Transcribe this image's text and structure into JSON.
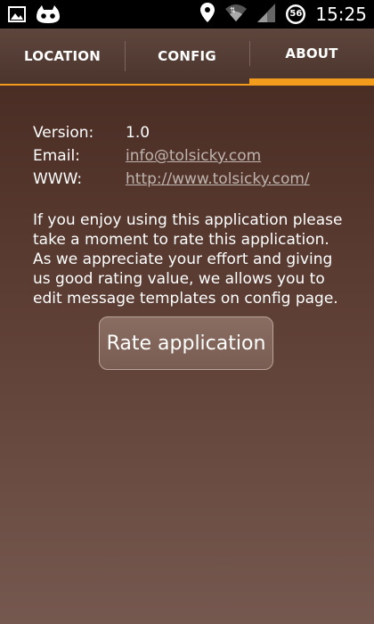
{
  "statusbar": {
    "time": "15:25",
    "badge": "56",
    "icons": [
      "image-icon",
      "cyanogen-mascot-icon",
      "location-pin-icon",
      "wifi-icon",
      "signal-icon",
      "badge-icon"
    ]
  },
  "tabs": [
    {
      "label": "LOCATION"
    },
    {
      "label": "CONFIG"
    },
    {
      "label": "ABOUT",
      "active": true
    }
  ],
  "about": {
    "version_label": "Version:",
    "version_value": "1.0",
    "email_label": "Email:",
    "email_value": "info@tolsicky.com",
    "www_label": "WWW:",
    "www_value": "http://www.tolsicky.com/",
    "description": "If you enjoy using this application please take a moment to rate this application. As we appreciate your effort and giving us good rating value, we allows you to edit message templates on config page.",
    "rate_button": "Rate application"
  },
  "colors": {
    "accent": "#f29b1d",
    "link": "#bfb4ae"
  }
}
